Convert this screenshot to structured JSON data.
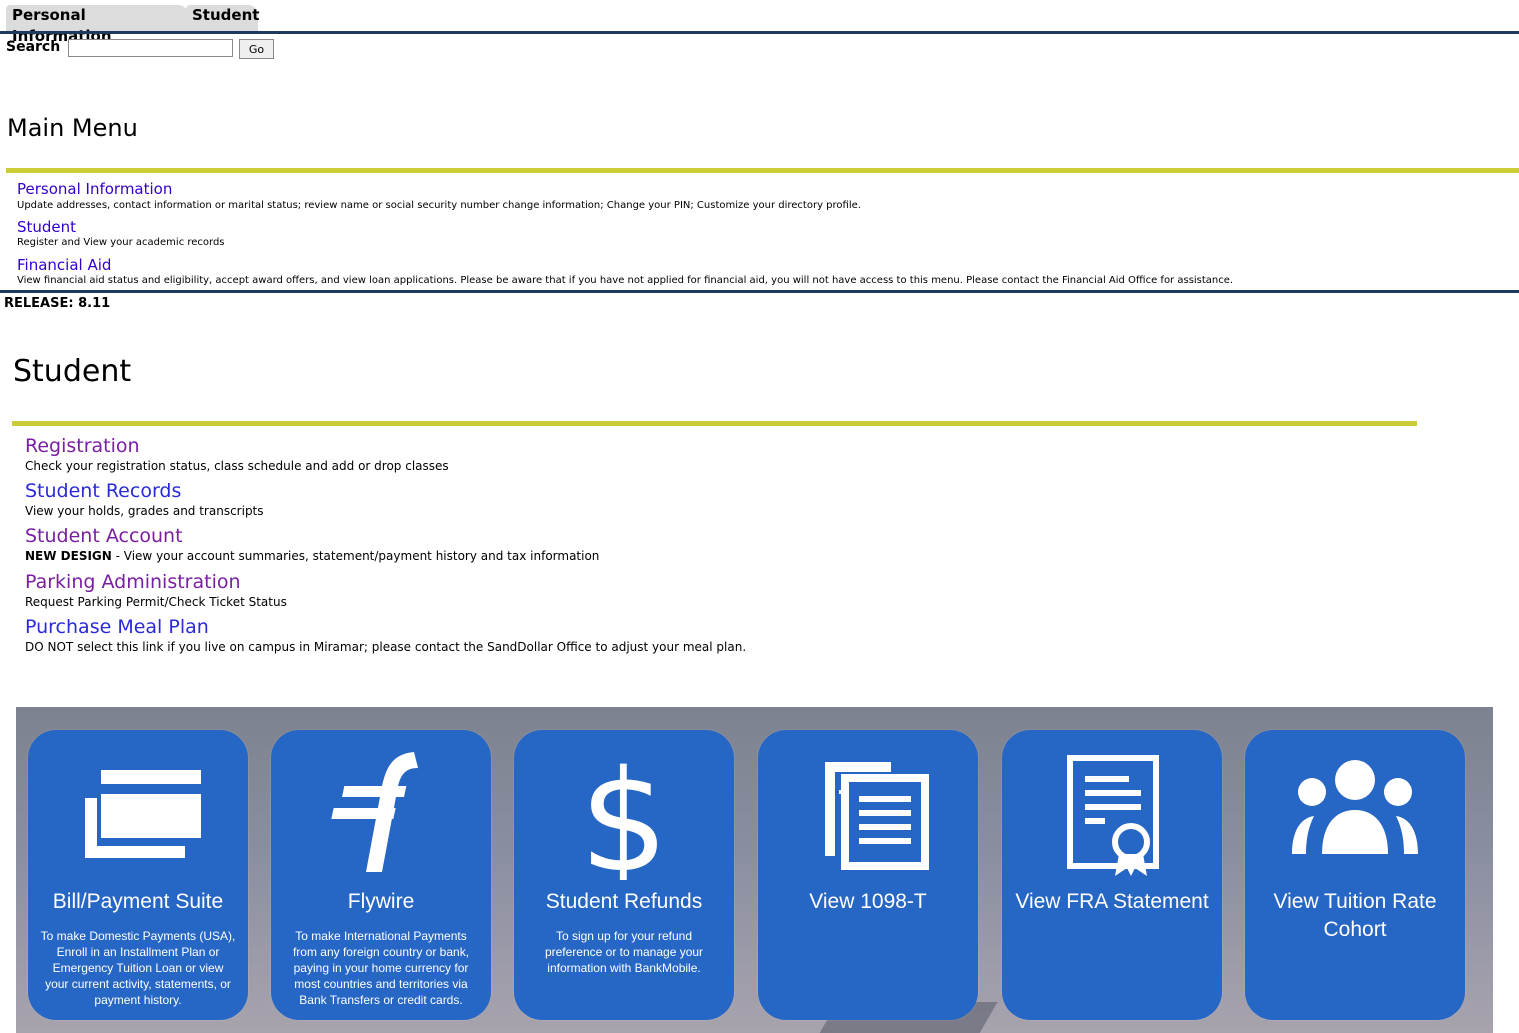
{
  "tabs": [
    "Personal Information",
    "Student"
  ],
  "search": {
    "label": "Search",
    "placeholder": "",
    "button": "Go"
  },
  "main_menu": {
    "title": "Main Menu",
    "items": [
      {
        "label": "Personal Information",
        "desc": "Update addresses, contact information or marital status; review name or social security number change information; Change your PIN; Customize your directory profile."
      },
      {
        "label": "Student",
        "desc": "Register and View your academic records"
      },
      {
        "label": "Financial Aid",
        "desc": "View financial aid status and eligibility, accept award offers, and view loan applications. Please be aware that if you have not applied for financial aid, you will not have access to this menu. Please contact the Financial Aid Office for assistance."
      }
    ]
  },
  "release": "RELEASE: 8.11",
  "student": {
    "title": "Student",
    "items": [
      {
        "label": "Registration",
        "desc": "Check your registration status, class schedule and add or drop classes"
      },
      {
        "label": "Student Records",
        "desc": "View your holds, grades and transcripts"
      },
      {
        "label": "Student Account",
        "desc_bold": "NEW DESIGN",
        "desc": " - View your account summaries, statement/payment history and tax information"
      },
      {
        "label": "Parking Administration",
        "desc": "Request Parking Permit/Check Ticket Status"
      },
      {
        "label": "Purchase Meal Plan",
        "desc": "DO NOT select this link if you live on campus in Miramar; please contact the SandDollar Office to adjust your meal plan."
      }
    ]
  },
  "tiles": [
    {
      "title": "Bill/Payment Suite",
      "icon": "credit-card-icon",
      "desc": "To make Domestic Payments (USA), Enroll in an Installment Plan or Emergency Tuition Loan or view your current activity, statements, or payment history."
    },
    {
      "title": "Flywire",
      "icon": "flywire-logo-icon",
      "desc": "To make International Payments from any foreign country or bank, paying in your home currency for most countries and territories via Bank Transfers or credit cards."
    },
    {
      "title": "Student Refunds",
      "icon": "dollar-icon",
      "desc": "To sign up for your refund preference or to manage your information with BankMobile."
    },
    {
      "title": "View 1098-T",
      "icon": "documents-icon",
      "desc": ""
    },
    {
      "title": "View FRA Statement",
      "icon": "certificate-icon",
      "desc": ""
    },
    {
      "title": "View Tuition Rate Cohort",
      "icon": "group-icon",
      "desc": ""
    }
  ],
  "colors": {
    "navy": "#1f3a5f",
    "olive": "#cbcc36",
    "tile_blue": "#2666c4",
    "link_visited": "#7a1fa2",
    "link_new": "#2a2ad8"
  }
}
